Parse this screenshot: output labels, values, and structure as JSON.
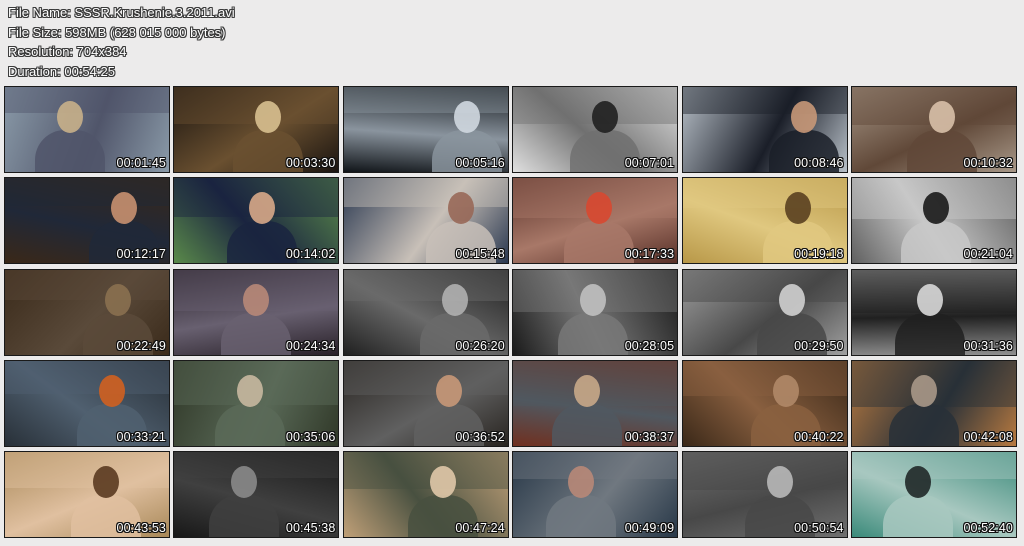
{
  "file_info": {
    "file_name": "File Name: SSSR.Krushenie.3.2011.avi",
    "file_size": "File Size: 598MB (628 015 000 bytes)",
    "resolution": "Resolution: 704x384",
    "duration": "Duration: 00:54:25"
  },
  "thumbnails": [
    {
      "time": "00:01:45",
      "colors": [
        "#8a9aa8",
        "#50556a",
        "#c8b08a"
      ]
    },
    {
      "time": "00:03:30",
      "colors": [
        "#1a1410",
        "#6a5030",
        "#d8c090"
      ]
    },
    {
      "time": "00:05:16",
      "colors": [
        "#101418",
        "#8a949e",
        "#d0d8e0"
      ]
    },
    {
      "time": "00:07:01",
      "colors": [
        "#e0e0e0",
        "#707070",
        "#202020"
      ]
    },
    {
      "time": "00:08:46",
      "colors": [
        "#b8c0c8",
        "#1a1e28",
        "#c89878"
      ]
    },
    {
      "time": "00:10:32",
      "colors": [
        "#a89888",
        "#604838",
        "#d8c0a8"
      ]
    },
    {
      "time": "00:12:17",
      "colors": [
        "#3a2818",
        "#202838",
        "#c89070"
      ]
    },
    {
      "time": "00:14:02",
      "colors": [
        "#5a8a4a",
        "#1a2440",
        "#d8a888"
      ]
    },
    {
      "time": "00:15:48",
      "colors": [
        "#2a3850",
        "#c8c0b8",
        "#986858"
      ]
    },
    {
      "time": "00:17:33",
      "colors": [
        "#583028",
        "#a87868",
        "#d84830"
      ]
    },
    {
      "time": "00:19:18",
      "colors": [
        "#b89848",
        "#e0c880",
        "#5a4020"
      ]
    },
    {
      "time": "00:21:04",
      "colors": [
        "#606060",
        "#c8c8c8",
        "#1a1a1a"
      ]
    },
    {
      "time": "00:22:49",
      "colors": [
        "#3a2a1a",
        "#5a4a3a",
        "#8a7050"
      ]
    },
    {
      "time": "00:24:34",
      "colors": [
        "#282028",
        "#686070",
        "#b88878"
      ]
    },
    {
      "time": "00:26:20",
      "colors": [
        "#202020",
        "#6a6a6a",
        "#b0b0b0"
      ]
    },
    {
      "time": "00:28:05",
      "colors": [
        "#1a1a1a",
        "#787878",
        "#c0c0c0"
      ]
    },
    {
      "time": "00:29:50",
      "colors": [
        "#a0a0a0",
        "#484848",
        "#d0d0d0"
      ]
    },
    {
      "time": "00:31:36",
      "colors": [
        "#909090",
        "#202020",
        "#d8d8d8"
      ]
    },
    {
      "time": "00:33:21",
      "colors": [
        "#283038",
        "#506070",
        "#d06020"
      ]
    },
    {
      "time": "00:35:06",
      "colors": [
        "#303828",
        "#5a6a58",
        "#c8b8a0"
      ]
    },
    {
      "time": "00:36:52",
      "colors": [
        "#282420",
        "#606060",
        "#c89878"
      ]
    },
    {
      "time": "00:38:37",
      "colors": [
        "#703020",
        "#505860",
        "#c8a888"
      ]
    },
    {
      "time": "00:40:22",
      "colors": [
        "#3a2818",
        "#8a6040",
        "#b08868"
      ]
    },
    {
      "time": "00:42:08",
      "colors": [
        "#b87a40",
        "#283038",
        "#a89888"
      ]
    },
    {
      "time": "00:43:53",
      "colors": [
        "#a88858",
        "#e0c0a0",
        "#5a3a20"
      ]
    },
    {
      "time": "00:45:38",
      "colors": [
        "#181818",
        "#404040",
        "#8a8a8a"
      ]
    },
    {
      "time": "00:47:24",
      "colors": [
        "#c0a078",
        "#485040",
        "#e0c8a8"
      ]
    },
    {
      "time": "00:49:09",
      "colors": [
        "#283848",
        "#707880",
        "#b88878"
      ]
    },
    {
      "time": "00:50:54",
      "colors": [
        "#707070",
        "#484848",
        "#b8b8b8"
      ]
    },
    {
      "time": "00:52:40",
      "colors": [
        "#3a8a7a",
        "#a8c8c0",
        "#202828"
      ]
    }
  ]
}
